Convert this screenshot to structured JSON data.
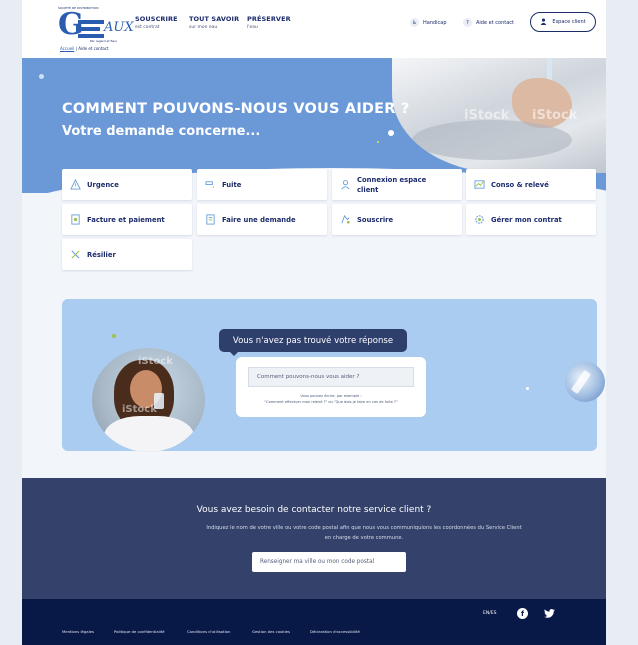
{
  "header": {
    "logo": {
      "top_text": "SOCIÉTÉ DE DISTRIBUTION",
      "letters": "G",
      "eaux": "AUX",
      "sub_text": "Par regard et fleur"
    },
    "breadcrumb": {
      "home": "Accueil",
      "separator": "|",
      "current": "Aide et contact"
    },
    "nav": [
      {
        "title": "SOUSCRIRE",
        "sub": "est contrat"
      },
      {
        "title": "TOUT SAVOIR",
        "sub": "sur mon eau"
      },
      {
        "title": "PRÉSERVER",
        "sub": "l'eau"
      }
    ],
    "handicap": "Handicap",
    "aide": "Aide et contact",
    "espace_client": "Espace client"
  },
  "hero": {
    "title": "COMMENT POUVONS-NOUS VOUS AIDER ?",
    "subtitle": "Votre demande concerne...",
    "watermark": "iStock"
  },
  "categories": [
    {
      "label": "Urgence",
      "icon": "warning-icon"
    },
    {
      "label": "Fuite",
      "icon": "leak-icon"
    },
    {
      "label": "Connexion espace client",
      "icon": "user-icon"
    },
    {
      "label": "Conso & relevé",
      "icon": "meter-icon"
    },
    {
      "label": "Facture et paiement",
      "icon": "invoice-icon"
    },
    {
      "label": "Faire une demande",
      "icon": "form-icon"
    },
    {
      "label": "Souscrire",
      "icon": "subscribe-icon"
    },
    {
      "label": "Gérer mon contrat",
      "icon": "settings-icon"
    },
    {
      "label": "Résilier",
      "icon": "cancel-icon"
    }
  ],
  "search": {
    "bubble_title": "Vous n'avez pas trouvé votre réponse",
    "placeholder": "Comment pouvons-nous vous aider ?",
    "hint_line1": "Vous pouvez écrire, par exemple :",
    "hint_line2": "\"Comment effectuer mon relevé ?\" ou \"Que dois-je faire en cas de fuite ?\""
  },
  "contact": {
    "title": "Vous avez besoin de contacter notre service client ?",
    "desc": "Indiquez le nom de votre ville ou votre code postal afin que nous vous communiquions les coordonnées du Service Client en charge de votre commune.",
    "placeholder": "Renseigner ma ville ou mon code postal"
  },
  "footer": {
    "lang": "EN/ES",
    "social": [
      "facebook-icon",
      "twitter-icon"
    ],
    "links": [
      "Mentions légales",
      "Politique de confidentialité",
      "Conditions d'utilisation",
      "Gestion des cookies",
      "Déclaration d'accessibilité"
    ]
  },
  "colors": {
    "navy": "#1b2b6b",
    "hero_blue": "#6b99d8",
    "light_blue": "#a9ccf0",
    "contact_bg": "#33416b",
    "footer_bg": "#081847"
  }
}
